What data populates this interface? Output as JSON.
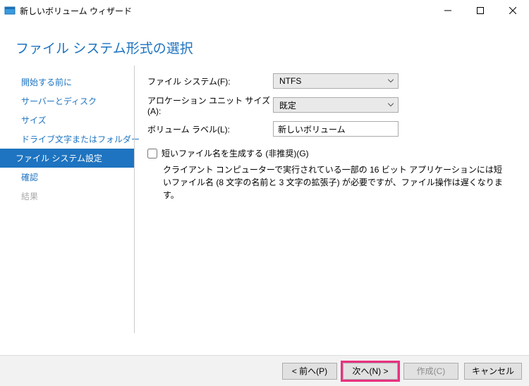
{
  "titlebar": {
    "title": "新しいボリューム ウィザード"
  },
  "heading": "ファイル システム形式の選択",
  "nav": {
    "items": [
      {
        "label": "開始する前に"
      },
      {
        "label": "サーバーとディスク"
      },
      {
        "label": "サイズ"
      },
      {
        "label": "ドライブ文字またはフォルダー"
      },
      {
        "label": "ファイル システム設定"
      },
      {
        "label": "確認"
      },
      {
        "label": "結果"
      }
    ]
  },
  "form": {
    "filesystem_label": "ファイル システム(F):",
    "filesystem_value": "NTFS",
    "allocation_label": "アロケーション ユニット サイズ(A):",
    "allocation_value": "既定",
    "volume_label_label": "ボリューム ラベル(L):",
    "volume_label_value": "新しいボリューム",
    "shortnames_label": "短いファイル名を生成する (非推奨)(G)",
    "shortnames_hint": "クライアント コンピューターで実行されている一部の 16 ビット アプリケーションには短いファイル名 (8 文字の名前と 3 文字の拡張子) が必要ですが、ファイル操作は遅くなります。"
  },
  "footer": {
    "prev": "< 前へ(P)",
    "next": "次へ(N) >",
    "create": "作成(C)",
    "cancel": "キャンセル"
  }
}
